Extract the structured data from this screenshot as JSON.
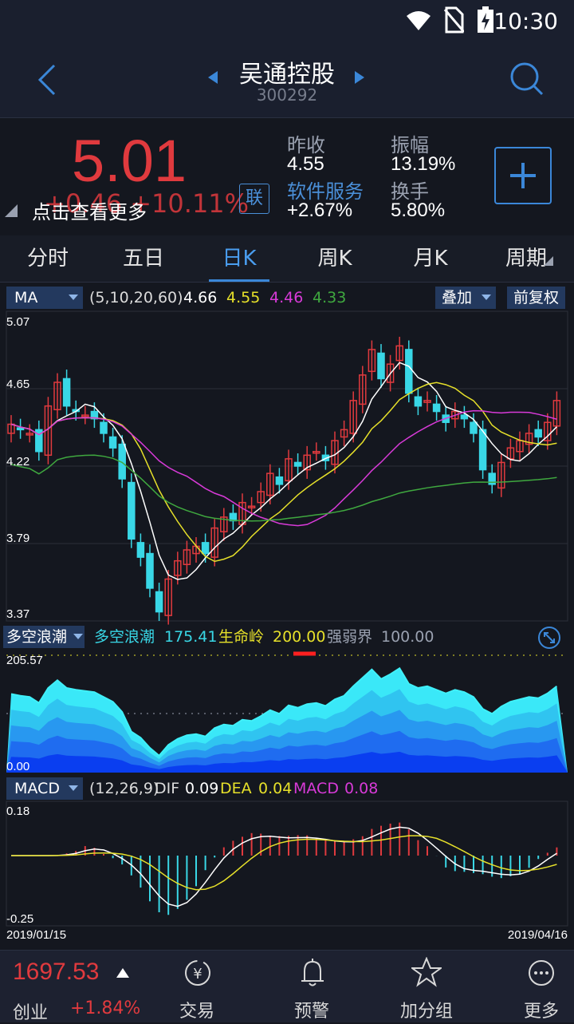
{
  "status": {
    "time": "10:30"
  },
  "header": {
    "title": "吴通控股",
    "code": "300292"
  },
  "quote": {
    "price": "5.01",
    "change": "+0.46  +10.11%",
    "tip": "点击查看更多",
    "lian": "联",
    "prev_close_label": "昨收",
    "prev_close": "4.55",
    "amplitude_label": "振幅",
    "amplitude": "13.19%",
    "sector_label": "软件服务",
    "sector_change": "+2.67%",
    "turnover_label": "换手",
    "turnover": "5.80%"
  },
  "tabs": [
    "分时",
    "五日",
    "日K",
    "周K",
    "月K",
    "周期"
  ],
  "active_tab": "日K",
  "ma_bar": {
    "select": "MA",
    "params": "(5,10,20,60)",
    "ma5": "4.66",
    "ma10": "4.55",
    "ma20": "4.46",
    "ma60": "4.33",
    "overlay": "叠加",
    "adjust": "前复权"
  },
  "kline_axis": [
    "5.07",
    "4.65",
    "4.22",
    "3.79",
    "3.37"
  ],
  "duokong_bar": {
    "select": "多空浪潮",
    "name": "多空浪潮",
    "value": "175.41",
    "life_label": "生命岭",
    "life_value": "200.00",
    "strength_label": "强弱界",
    "strength_value": "100.00"
  },
  "duokong_axis": [
    "205.57",
    "0.00"
  ],
  "macd_bar": {
    "select": "MACD",
    "params": "(12,26,9)",
    "dif_label": "DIF",
    "dif": "0.09",
    "dea_label": "DEA",
    "dea": "0.04",
    "macd_label": "MACD",
    "macd": "0.08"
  },
  "macd_axis": [
    "0.18",
    "-0.25"
  ],
  "dates": {
    "start": "2019/01/15",
    "end": "2019/04/16"
  },
  "bottom": {
    "index_value": "1697.53",
    "index_name": "创业",
    "index_change": "+1.84%",
    "nav": [
      "交易",
      "预警",
      "加分组",
      "更多"
    ]
  },
  "colors": {
    "up": "#e03a3e",
    "down": "#39d7e6",
    "ma5": "#ffffff",
    "ma10": "#e6e02a",
    "ma20": "#d83ad8",
    "ma60": "#3fa83f",
    "accent": "#3b87d8"
  }
}
